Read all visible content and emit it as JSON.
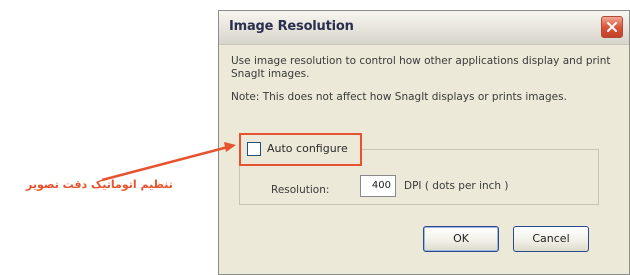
{
  "dialog": {
    "title": "Image Resolution",
    "description": "Use image resolution to control how other applications display and print SnagIt images.",
    "note": "Note: This does not affect how SnagIt displays or prints images.",
    "auto_configure": {
      "label": "Auto configure",
      "checked": false
    },
    "resolution": {
      "label": "Resolution:",
      "value": "400",
      "unit": "DPI ( dots per inch )"
    },
    "buttons": {
      "ok": "OK",
      "cancel": "Cancel"
    }
  },
  "annotation": {
    "text": "تنظیم اتوماتیک دقت تصویر",
    "color": "#e8532f"
  },
  "icons": {
    "close": "close-icon",
    "checkbox": "checkbox-icon",
    "arrow": "arrow-icon"
  }
}
